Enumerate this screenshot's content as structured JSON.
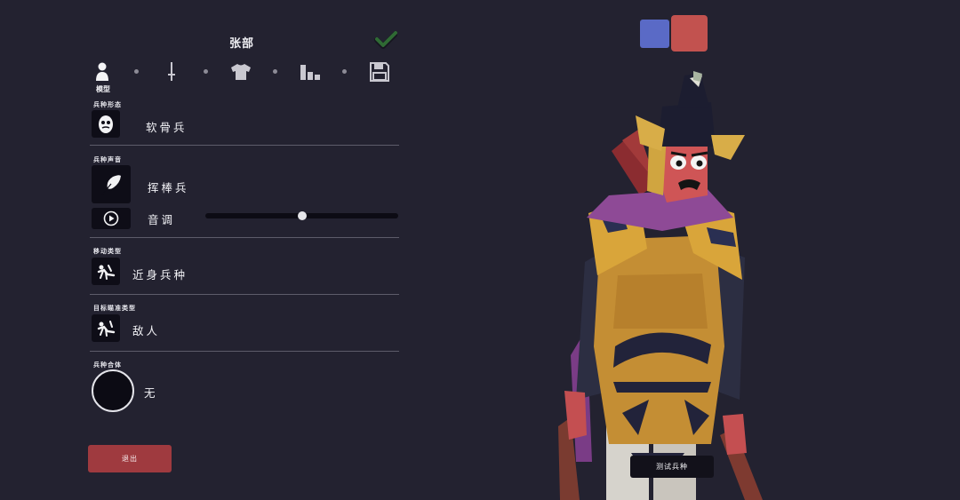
{
  "header": {
    "unit_name": "张部"
  },
  "tabs": [
    {
      "name": "model",
      "label": "模型",
      "icon": "person-icon",
      "active": true
    },
    {
      "name": "weapon",
      "icon": "sword-icon"
    },
    {
      "name": "clothing",
      "icon": "shirt-icon"
    },
    {
      "name": "stats",
      "icon": "bar-chart-icon"
    },
    {
      "name": "save",
      "icon": "floppy-disk-icon"
    }
  ],
  "sections": {
    "form": {
      "label": "兵种形态",
      "value": "软骨兵",
      "icon": "mask-face-icon"
    },
    "voice": {
      "label": "兵种声音",
      "value": "挥棒兵",
      "icon": "feather-icon",
      "pitch_label": "音调",
      "pitch_icon": "play-icon",
      "pitch_level": 0.5
    },
    "movement": {
      "label": "移动类型",
      "value": "近身兵种",
      "icon": "melee-movement-icon"
    },
    "targeting": {
      "label": "目标瞄准类型",
      "value": "敌人",
      "icon": "target-enemy-icon"
    },
    "combine": {
      "label": "兵种合体",
      "value": "无"
    }
  },
  "buttons": {
    "exit": "退出",
    "test_unit": "测试兵种"
  },
  "teams": [
    {
      "name": "blue",
      "color": "#5a6ac6"
    },
    {
      "name": "red",
      "color": "#c2524f",
      "selected": true
    }
  ],
  "colors": {
    "accent_red": "#9f3a3f",
    "confirm_green": "#2f6a34",
    "background": "#232230"
  }
}
